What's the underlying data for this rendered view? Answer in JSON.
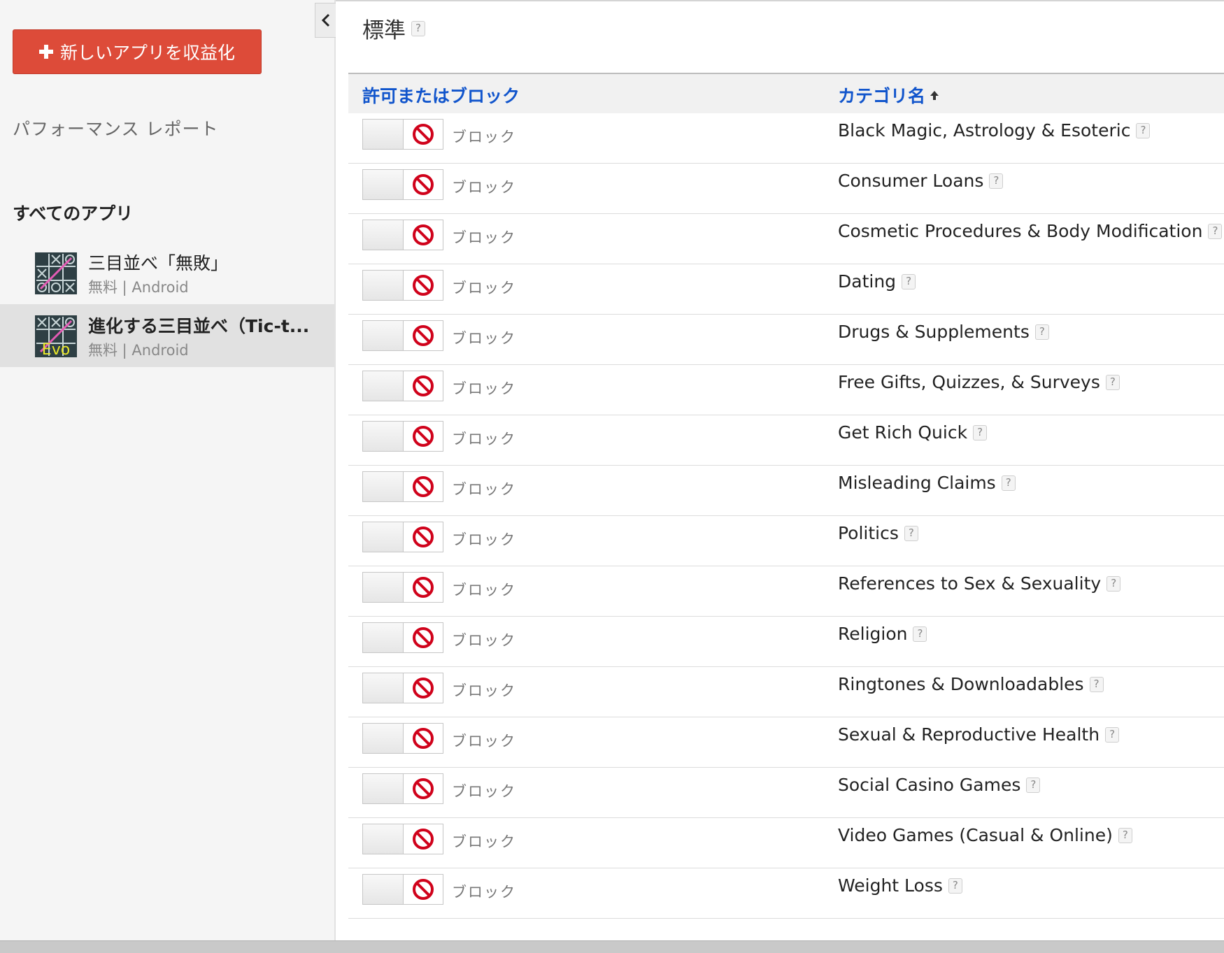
{
  "sidebar": {
    "new_app_button": "新しいアプリを収益化",
    "performance_report": "パフォーマンス レポート",
    "all_apps_heading": "すべてのアプリ",
    "apps": [
      {
        "name": "三目並べ「無敗」",
        "meta": "無料 | Android",
        "selected": false,
        "icon": "tic-tac-toe-icon"
      },
      {
        "name": "進化する三目並べ（Tic-t...",
        "meta": "無料 | Android",
        "selected": true,
        "icon": "tic-tac-toe-evo-icon",
        "icon_text": "Evo"
      }
    ]
  },
  "main": {
    "title": "標準",
    "help_label": "?",
    "table": {
      "columns": [
        "許可またはブロック",
        "カテゴリ名"
      ],
      "sort_column": "カテゴリ名",
      "rows": [
        {
          "status": "ブロック",
          "category": "Black Magic, Astrology & Esoteric"
        },
        {
          "status": "ブロック",
          "category": "Consumer Loans"
        },
        {
          "status": "ブロック",
          "category": "Cosmetic Procedures & Body Modification"
        },
        {
          "status": "ブロック",
          "category": "Dating"
        },
        {
          "status": "ブロック",
          "category": "Drugs & Supplements"
        },
        {
          "status": "ブロック",
          "category": "Free Gifts, Quizzes, & Surveys"
        },
        {
          "status": "ブロック",
          "category": "Get Rich Quick"
        },
        {
          "status": "ブロック",
          "category": "Misleading Claims"
        },
        {
          "status": "ブロック",
          "category": "Politics"
        },
        {
          "status": "ブロック",
          "category": "References to Sex & Sexuality"
        },
        {
          "status": "ブロック",
          "category": "Religion"
        },
        {
          "status": "ブロック",
          "category": "Ringtones & Downloadables"
        },
        {
          "status": "ブロック",
          "category": "Sexual & Reproductive Health"
        },
        {
          "status": "ブロック",
          "category": "Social Casino Games"
        },
        {
          "status": "ブロック",
          "category": "Video Games (Casual & Online)"
        },
        {
          "status": "ブロック",
          "category": "Weight Loss"
        }
      ]
    }
  },
  "colors": {
    "primary_button": "#dd4b39",
    "link_blue": "#1155cc",
    "block_red": "#d0021b"
  }
}
